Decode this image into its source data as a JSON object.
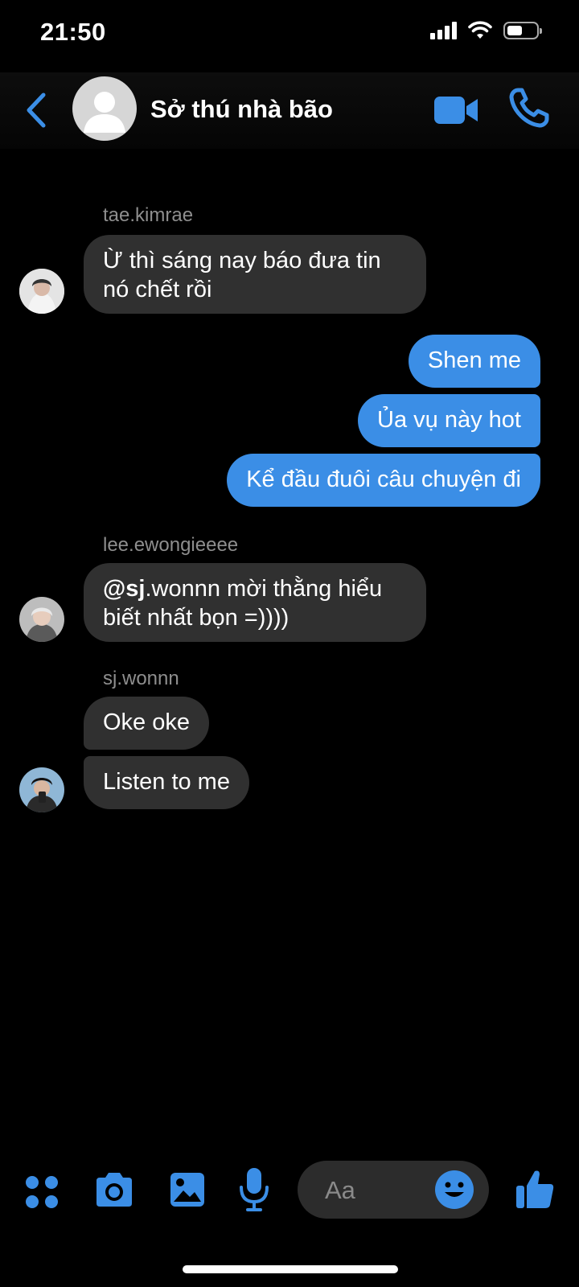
{
  "status_bar": {
    "time": "21:50"
  },
  "header": {
    "title": "Sở thú nhà bão"
  },
  "messages": [
    {
      "sender": "tae.kimrae",
      "texts": [
        "Ừ thì sáng nay báo đưa tin nó chết rồi"
      ]
    },
    {
      "outgoing": [
        "Shen me",
        "Ủa vụ này hot",
        "Kể đầu đuôi câu chuyện đi"
      ]
    },
    {
      "sender": "lee.ewongieeee",
      "mention": "@sj",
      "text_after_mention": ".wonnn mời thằng hiểu biết nhất bọn =))))"
    },
    {
      "sender": "sj.wonnn",
      "texts": [
        "Oke oke",
        "Listen to me"
      ]
    }
  ],
  "composer": {
    "placeholder": "Aa"
  },
  "colors": {
    "accent": "#3b8ee6",
    "incoming_bubble": "#303030",
    "background": "#000000"
  },
  "icons": [
    "back-arrow-icon",
    "video-call-icon",
    "phone-icon",
    "apps-icon",
    "camera-icon",
    "gallery-icon",
    "microphone-icon",
    "emoji-icon",
    "thumbs-up-icon"
  ]
}
